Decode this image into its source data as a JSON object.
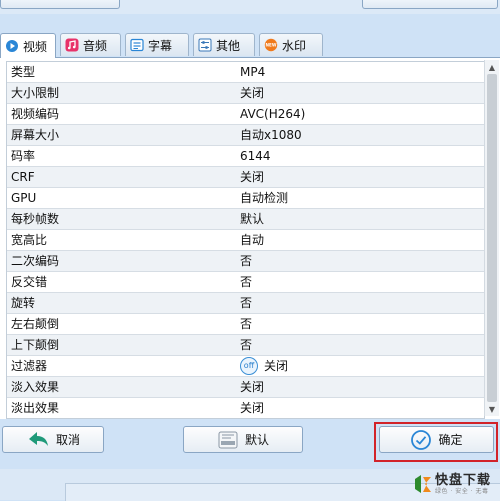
{
  "tabs": [
    {
      "label": "视频",
      "icon": "video-icon",
      "active": true
    },
    {
      "label": "音频",
      "icon": "music-icon",
      "active": false
    },
    {
      "label": "字幕",
      "icon": "subtitle-icon",
      "active": false
    },
    {
      "label": "其他",
      "icon": "settings-icon",
      "active": false
    },
    {
      "label": "水印",
      "icon": "watermark-icon",
      "active": false
    }
  ],
  "properties": [
    {
      "name": "类型",
      "value": "MP4"
    },
    {
      "name": "大小限制",
      "value": "关闭"
    },
    {
      "name": "视频编码",
      "value": "AVC(H264)"
    },
    {
      "name": "屏幕大小",
      "value": "自动x1080"
    },
    {
      "name": "码率",
      "value": "6144"
    },
    {
      "name": "CRF",
      "value": "关闭"
    },
    {
      "name": "GPU",
      "value": "自动检测"
    },
    {
      "name": "每秒帧数",
      "value": "默认"
    },
    {
      "name": "宽高比",
      "value": "自动"
    },
    {
      "name": "二次编码",
      "value": "否"
    },
    {
      "name": "反交错",
      "value": "否"
    },
    {
      "name": "旋转",
      "value": "否"
    },
    {
      "name": "左右颠倒",
      "value": "否"
    },
    {
      "name": "上下颠倒",
      "value": "否"
    },
    {
      "name": "过滤器",
      "value": "关闭",
      "badge": "off"
    },
    {
      "name": "淡入效果",
      "value": "关闭"
    },
    {
      "name": "淡出效果",
      "value": "关闭"
    }
  ],
  "buttons": {
    "cancel": "取消",
    "default": "默认",
    "confirm": "确定"
  },
  "watermark": {
    "brand": "快盘下载",
    "tagline": "绿色 · 安全 · 无毒"
  },
  "colors": {
    "highlight": "#d2232a",
    "accent": "#2a7fcc"
  }
}
